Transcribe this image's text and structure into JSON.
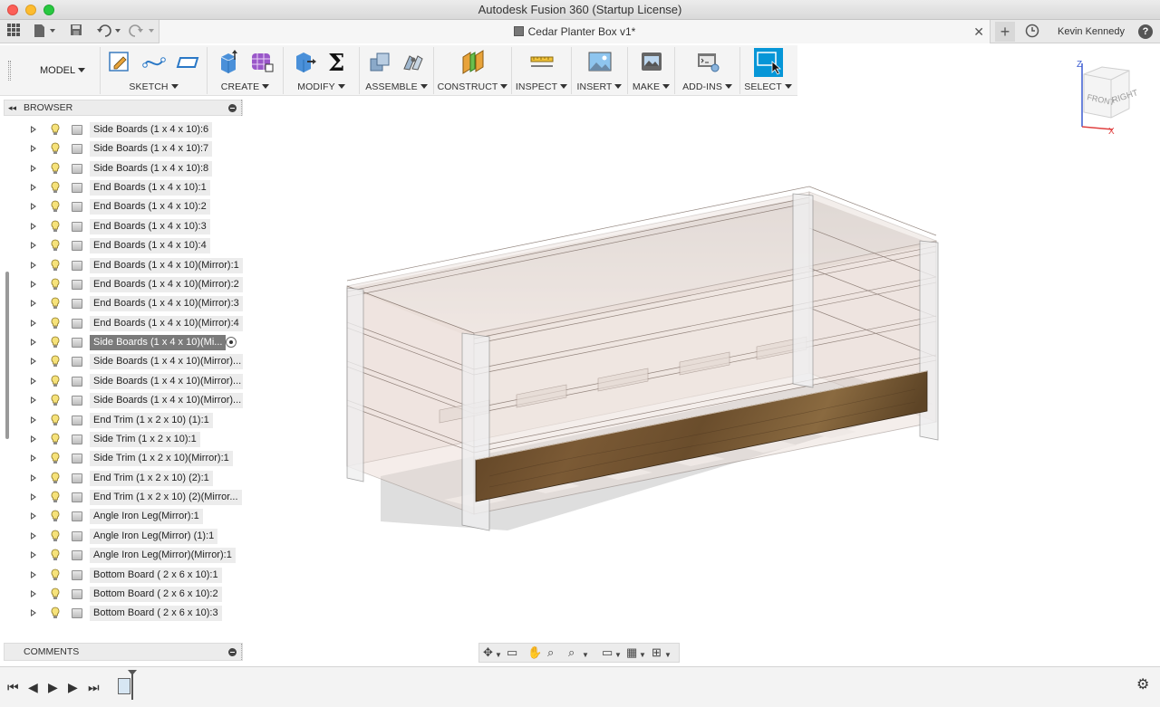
{
  "window": {
    "title": "Autodesk Fusion 360 (Startup License)"
  },
  "tabbar": {
    "doc_title": "Cedar Planter Box v1*",
    "close": "✕",
    "new_tab": "+",
    "user": "Kevin Kennedy",
    "help": "?"
  },
  "toolbar": {
    "workspace": "MODEL",
    "groups": [
      {
        "label": "SKETCH"
      },
      {
        "label": "CREATE"
      },
      {
        "label": "MODIFY"
      },
      {
        "label": "ASSEMBLE"
      },
      {
        "label": "CONSTRUCT"
      },
      {
        "label": "INSPECT"
      },
      {
        "label": "INSERT"
      },
      {
        "label": "MAKE"
      },
      {
        "label": "ADD-INS"
      },
      {
        "label": "SELECT"
      }
    ],
    "sigma": "Σ"
  },
  "browser": {
    "title": "BROWSER",
    "collapse": "◂◂",
    "items": [
      {
        "label": "Side Boards (1 x 4 x 10):6"
      },
      {
        "label": "Side Boards (1 x 4 x 10):7"
      },
      {
        "label": "Side Boards (1 x 4 x 10):8"
      },
      {
        "label": "End Boards (1 x 4 x 10):1"
      },
      {
        "label": "End Boards (1 x 4 x 10):2"
      },
      {
        "label": "End Boards (1 x 4 x 10):3"
      },
      {
        "label": "End Boards (1 x 4 x 10):4"
      },
      {
        "label": "End Boards (1 x 4 x 10)(Mirror):1"
      },
      {
        "label": "End Boards (1 x 4 x 10)(Mirror):2"
      },
      {
        "label": "End Boards (1 x 4 x 10)(Mirror):3"
      },
      {
        "label": "End Boards (1 x 4 x 10)(Mirror):4"
      },
      {
        "label": "Side Boards (1 x 4 x 10)(Mi...",
        "selected": true
      },
      {
        "label": "Side Boards (1 x 4 x 10)(Mirror)..."
      },
      {
        "label": "Side Boards (1 x 4 x 10)(Mirror)..."
      },
      {
        "label": "Side Boards (1 x 4 x 10)(Mirror)..."
      },
      {
        "label": "End Trim (1 x 2 x 10) (1):1"
      },
      {
        "label": "Side Trim (1 x 2 x 10):1"
      },
      {
        "label": "Side Trim (1 x 2 x 10)(Mirror):1"
      },
      {
        "label": "End Trim (1 x 2 x 10) (2):1"
      },
      {
        "label": "End Trim (1 x 2 x 10) (2)(Mirror..."
      },
      {
        "label": "Angle Iron Leg(Mirror):1"
      },
      {
        "label": "Angle Iron Leg(Mirror) (1):1"
      },
      {
        "label": "Angle Iron Leg(Mirror)(Mirror):1"
      },
      {
        "label": "Bottom Board ( 2 x 6 x 10):1"
      },
      {
        "label": "Bottom Board ( 2 x 6 x 10):2"
      },
      {
        "label": "Bottom Board ( 2 x 6 x 10):3"
      }
    ]
  },
  "comments": {
    "title": "COMMENTS"
  },
  "viewcube": {
    "front": "FRONT",
    "right": "RIGHT",
    "z": "Z",
    "x": "X"
  },
  "colors": {
    "accent_select": "#0696d7",
    "wood": "#6b4e2e",
    "selected_row": "#7a7a7a"
  }
}
